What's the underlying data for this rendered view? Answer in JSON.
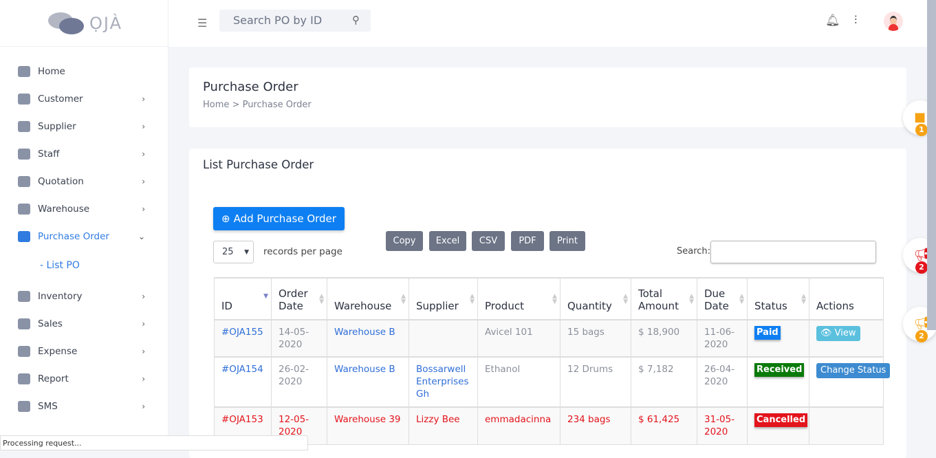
{
  "app": {
    "logo": "ỌJÀ"
  },
  "header": {
    "search_placeholder": "Search PO by ID"
  },
  "sidebar": {
    "items": [
      {
        "label": "Home",
        "chev": ""
      },
      {
        "label": "Customer",
        "chev": "›"
      },
      {
        "label": "Supplier",
        "chev": "›"
      },
      {
        "label": "Staff",
        "chev": "›"
      },
      {
        "label": "Quotation",
        "chev": "›"
      },
      {
        "label": "Warehouse",
        "chev": "›"
      },
      {
        "label": "Purchase Order",
        "chev": "⌄"
      },
      {
        "label": "Inventory",
        "chev": "›"
      },
      {
        "label": "Sales",
        "chev": "›"
      },
      {
        "label": "Expense",
        "chev": "›"
      },
      {
        "label": "Report",
        "chev": "›"
      },
      {
        "label": "SMS",
        "chev": "›"
      }
    ],
    "sub_item": "- List PO"
  },
  "page": {
    "title": "Purchase Order",
    "breadcrumb_home": "Home",
    "breadcrumb_sep": ">",
    "breadcrumb_current": "Purchase Order"
  },
  "list": {
    "title": "List Purchase Order",
    "add_button": "Add Purchase Order",
    "page_size": "25",
    "records_per_page": "records per page",
    "search_label": "Search:",
    "export_buttons": [
      "Copy",
      "Excel",
      "CSV",
      "PDF",
      "Print"
    ],
    "columns": [
      "ID",
      "Order Date",
      "Warehouse",
      "Supplier",
      "Product",
      "Quantity",
      "Total Amount",
      "Due Date",
      "Status",
      "Actions"
    ],
    "rows": [
      {
        "id": "#OJA155",
        "order_date": "14-05-2020",
        "warehouse": "Warehouse B",
        "supplier": "",
        "product": "Avicel 101",
        "quantity": "15 bags",
        "total": "$ 18,900",
        "due": "11-06-2020",
        "status": "Paid",
        "status_color": "#0d7ff2",
        "action": "View",
        "action_color": "#5bc0de"
      },
      {
        "id": "#OJA154",
        "order_date": "26-02-2020",
        "warehouse": "Warehouse B",
        "supplier": "Bossarwell Enterprises Gh",
        "product": "Ethanol",
        "quantity": "12 Drums",
        "total": "$ 7,182",
        "due": "26-04-2020",
        "status": "Received",
        "status_color": "#0a7a0a",
        "action": "Change Status",
        "action_color": "#3d8bd0"
      },
      {
        "id": "#OJA153",
        "order_date": "12-05-2020",
        "warehouse": "Warehouse 39",
        "supplier": "Lizzy Bee",
        "product": "emmadacinna",
        "quantity": "234 bags",
        "total": "$ 61,425",
        "due": "31-05-2020",
        "status": "Cancelled",
        "status_color": "#e3141c",
        "action": "",
        "action_color": ""
      }
    ]
  },
  "floats": [
    {
      "icon": "briefcase-icon",
      "count": "1",
      "color": "#f5a214"
    },
    {
      "icon": "megaphone-icon",
      "count": "2",
      "color": "#e3141c"
    },
    {
      "icon": "megaphone-icon",
      "count": "2",
      "color": "#f5a214"
    }
  ],
  "statusbar": "Processing request..."
}
